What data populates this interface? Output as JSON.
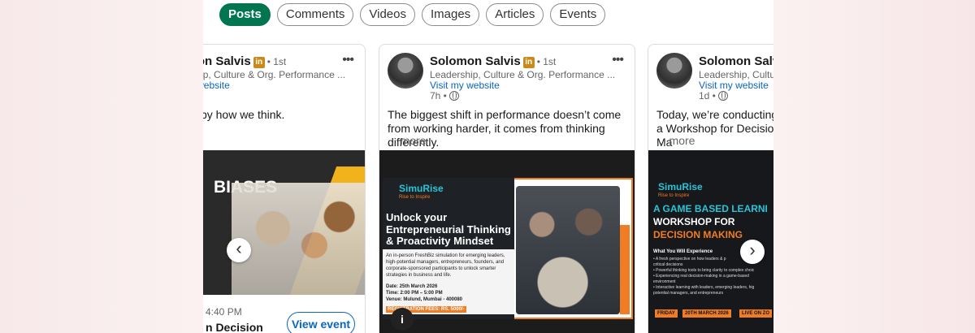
{
  "tabs": [
    {
      "label": "Posts",
      "active": true
    },
    {
      "label": "Comments"
    },
    {
      "label": "Videos"
    },
    {
      "label": "Images"
    },
    {
      "label": "Articles"
    },
    {
      "label": "Events"
    }
  ],
  "posts": [
    {
      "author": "Solomon Salvis",
      "degree": "• 1st",
      "headline": "Leadership, Culture & Org. Performance ...",
      "visit": "Visit my website",
      "time": "",
      "body": "make is shaped by how we think.",
      "more": "",
      "poster": {
        "heading": "BIASES",
        "event_time": "4:40 PM",
        "event_title": "n Decision",
        "button": "View event"
      }
    },
    {
      "author": "Solomon Salvis",
      "degree": "• 1st",
      "headline": "Leadership, Culture & Org. Performance ...",
      "visit": "Visit my website",
      "time": "7h •",
      "body": "The biggest shift in performance doesn’t come from working harder, it comes from thinking differently.",
      "more": "... more",
      "poster": {
        "logo": "SimuRise",
        "tagline": "Rise to Inspire",
        "heading": "Unlock your Entrepreneurial Thinking & Proactivity Mindset",
        "details": "An in-person FreshBiz simulation for emerging leaders, high-potential managers, entrepreneurs, founders, and corporate-sponsored participants to unlock smarter strategies in business and life.",
        "date": "Date: 25th March 2026",
        "time": "Time: 2:00 PM – 5:00 PM",
        "venue": "Venue: Mulund, Mumbai - 400080",
        "fee": "REGISTRATION FEES: RS. 5000/-"
      }
    },
    {
      "author": "Solomon Salvis",
      "degree": "",
      "headline": "Leadership, Culture & Org. Performance",
      "visit": "Visit my website",
      "time": "1d •",
      "body": "Today, we’re conducting a Workshop for Decision Ma",
      "more": "... more",
      "poster": {
        "logo": "SimuRise",
        "tagline": "Rise to Inspire",
        "heading1": "A GAME BASED LEARNI",
        "heading2": "WORKSHOP FOR",
        "heading3": "DECISION MAKING",
        "sub": "What You Will Experience",
        "bullets": "• A fresh perspective on how leaders & p\ncritical decisions\n• Powerful thinking tools to bring clarity to complex choic\n• Experiencing real decision-making in a game-based\nenvironment\n• Interactive learning with leaders, emerging leaders, hig\npotential managers, and entrepreneurs",
        "tags": [
          "FRIDAY",
          "20TH MARCH 2026",
          "LIVE ON ZO"
        ]
      }
    }
  ],
  "colors": {
    "accent": "#01754f",
    "link": "#0a66c2",
    "poster_orange": "#f07d23",
    "poster_cyan": "#29c3d6"
  }
}
